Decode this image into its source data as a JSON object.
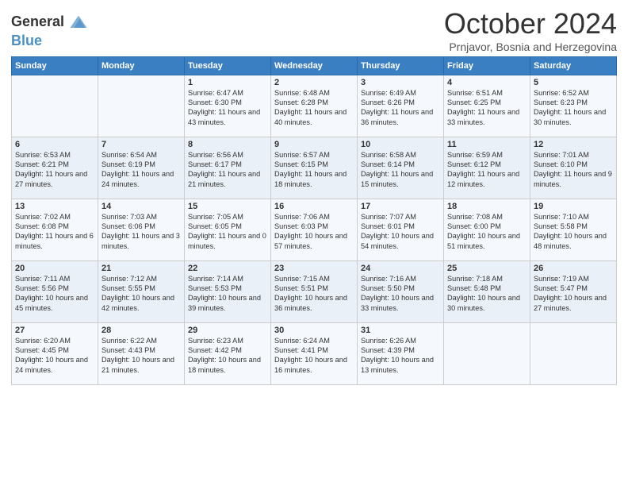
{
  "logo": {
    "line1": "General",
    "line2": "Blue"
  },
  "title": "October 2024",
  "subtitle": "Prnjavor, Bosnia and Herzegovina",
  "headers": [
    "Sunday",
    "Monday",
    "Tuesday",
    "Wednesday",
    "Thursday",
    "Friday",
    "Saturday"
  ],
  "weeks": [
    [
      {
        "day": "",
        "text": ""
      },
      {
        "day": "",
        "text": ""
      },
      {
        "day": "1",
        "text": "Sunrise: 6:47 AM\nSunset: 6:30 PM\nDaylight: 11 hours and 43 minutes."
      },
      {
        "day": "2",
        "text": "Sunrise: 6:48 AM\nSunset: 6:28 PM\nDaylight: 11 hours and 40 minutes."
      },
      {
        "day": "3",
        "text": "Sunrise: 6:49 AM\nSunset: 6:26 PM\nDaylight: 11 hours and 36 minutes."
      },
      {
        "day": "4",
        "text": "Sunrise: 6:51 AM\nSunset: 6:25 PM\nDaylight: 11 hours and 33 minutes."
      },
      {
        "day": "5",
        "text": "Sunrise: 6:52 AM\nSunset: 6:23 PM\nDaylight: 11 hours and 30 minutes."
      }
    ],
    [
      {
        "day": "6",
        "text": "Sunrise: 6:53 AM\nSunset: 6:21 PM\nDaylight: 11 hours and 27 minutes."
      },
      {
        "day": "7",
        "text": "Sunrise: 6:54 AM\nSunset: 6:19 PM\nDaylight: 11 hours and 24 minutes."
      },
      {
        "day": "8",
        "text": "Sunrise: 6:56 AM\nSunset: 6:17 PM\nDaylight: 11 hours and 21 minutes."
      },
      {
        "day": "9",
        "text": "Sunrise: 6:57 AM\nSunset: 6:15 PM\nDaylight: 11 hours and 18 minutes."
      },
      {
        "day": "10",
        "text": "Sunrise: 6:58 AM\nSunset: 6:14 PM\nDaylight: 11 hours and 15 minutes."
      },
      {
        "day": "11",
        "text": "Sunrise: 6:59 AM\nSunset: 6:12 PM\nDaylight: 11 hours and 12 minutes."
      },
      {
        "day": "12",
        "text": "Sunrise: 7:01 AM\nSunset: 6:10 PM\nDaylight: 11 hours and 9 minutes."
      }
    ],
    [
      {
        "day": "13",
        "text": "Sunrise: 7:02 AM\nSunset: 6:08 PM\nDaylight: 11 hours and 6 minutes."
      },
      {
        "day": "14",
        "text": "Sunrise: 7:03 AM\nSunset: 6:06 PM\nDaylight: 11 hours and 3 minutes."
      },
      {
        "day": "15",
        "text": "Sunrise: 7:05 AM\nSunset: 6:05 PM\nDaylight: 11 hours and 0 minutes."
      },
      {
        "day": "16",
        "text": "Sunrise: 7:06 AM\nSunset: 6:03 PM\nDaylight: 10 hours and 57 minutes."
      },
      {
        "day": "17",
        "text": "Sunrise: 7:07 AM\nSunset: 6:01 PM\nDaylight: 10 hours and 54 minutes."
      },
      {
        "day": "18",
        "text": "Sunrise: 7:08 AM\nSunset: 6:00 PM\nDaylight: 10 hours and 51 minutes."
      },
      {
        "day": "19",
        "text": "Sunrise: 7:10 AM\nSunset: 5:58 PM\nDaylight: 10 hours and 48 minutes."
      }
    ],
    [
      {
        "day": "20",
        "text": "Sunrise: 7:11 AM\nSunset: 5:56 PM\nDaylight: 10 hours and 45 minutes."
      },
      {
        "day": "21",
        "text": "Sunrise: 7:12 AM\nSunset: 5:55 PM\nDaylight: 10 hours and 42 minutes."
      },
      {
        "day": "22",
        "text": "Sunrise: 7:14 AM\nSunset: 5:53 PM\nDaylight: 10 hours and 39 minutes."
      },
      {
        "day": "23",
        "text": "Sunrise: 7:15 AM\nSunset: 5:51 PM\nDaylight: 10 hours and 36 minutes."
      },
      {
        "day": "24",
        "text": "Sunrise: 7:16 AM\nSunset: 5:50 PM\nDaylight: 10 hours and 33 minutes."
      },
      {
        "day": "25",
        "text": "Sunrise: 7:18 AM\nSunset: 5:48 PM\nDaylight: 10 hours and 30 minutes."
      },
      {
        "day": "26",
        "text": "Sunrise: 7:19 AM\nSunset: 5:47 PM\nDaylight: 10 hours and 27 minutes."
      }
    ],
    [
      {
        "day": "27",
        "text": "Sunrise: 6:20 AM\nSunset: 4:45 PM\nDaylight: 10 hours and 24 minutes."
      },
      {
        "day": "28",
        "text": "Sunrise: 6:22 AM\nSunset: 4:43 PM\nDaylight: 10 hours and 21 minutes."
      },
      {
        "day": "29",
        "text": "Sunrise: 6:23 AM\nSunset: 4:42 PM\nDaylight: 10 hours and 18 minutes."
      },
      {
        "day": "30",
        "text": "Sunrise: 6:24 AM\nSunset: 4:41 PM\nDaylight: 10 hours and 16 minutes."
      },
      {
        "day": "31",
        "text": "Sunrise: 6:26 AM\nSunset: 4:39 PM\nDaylight: 10 hours and 13 minutes."
      },
      {
        "day": "",
        "text": ""
      },
      {
        "day": "",
        "text": ""
      }
    ]
  ]
}
